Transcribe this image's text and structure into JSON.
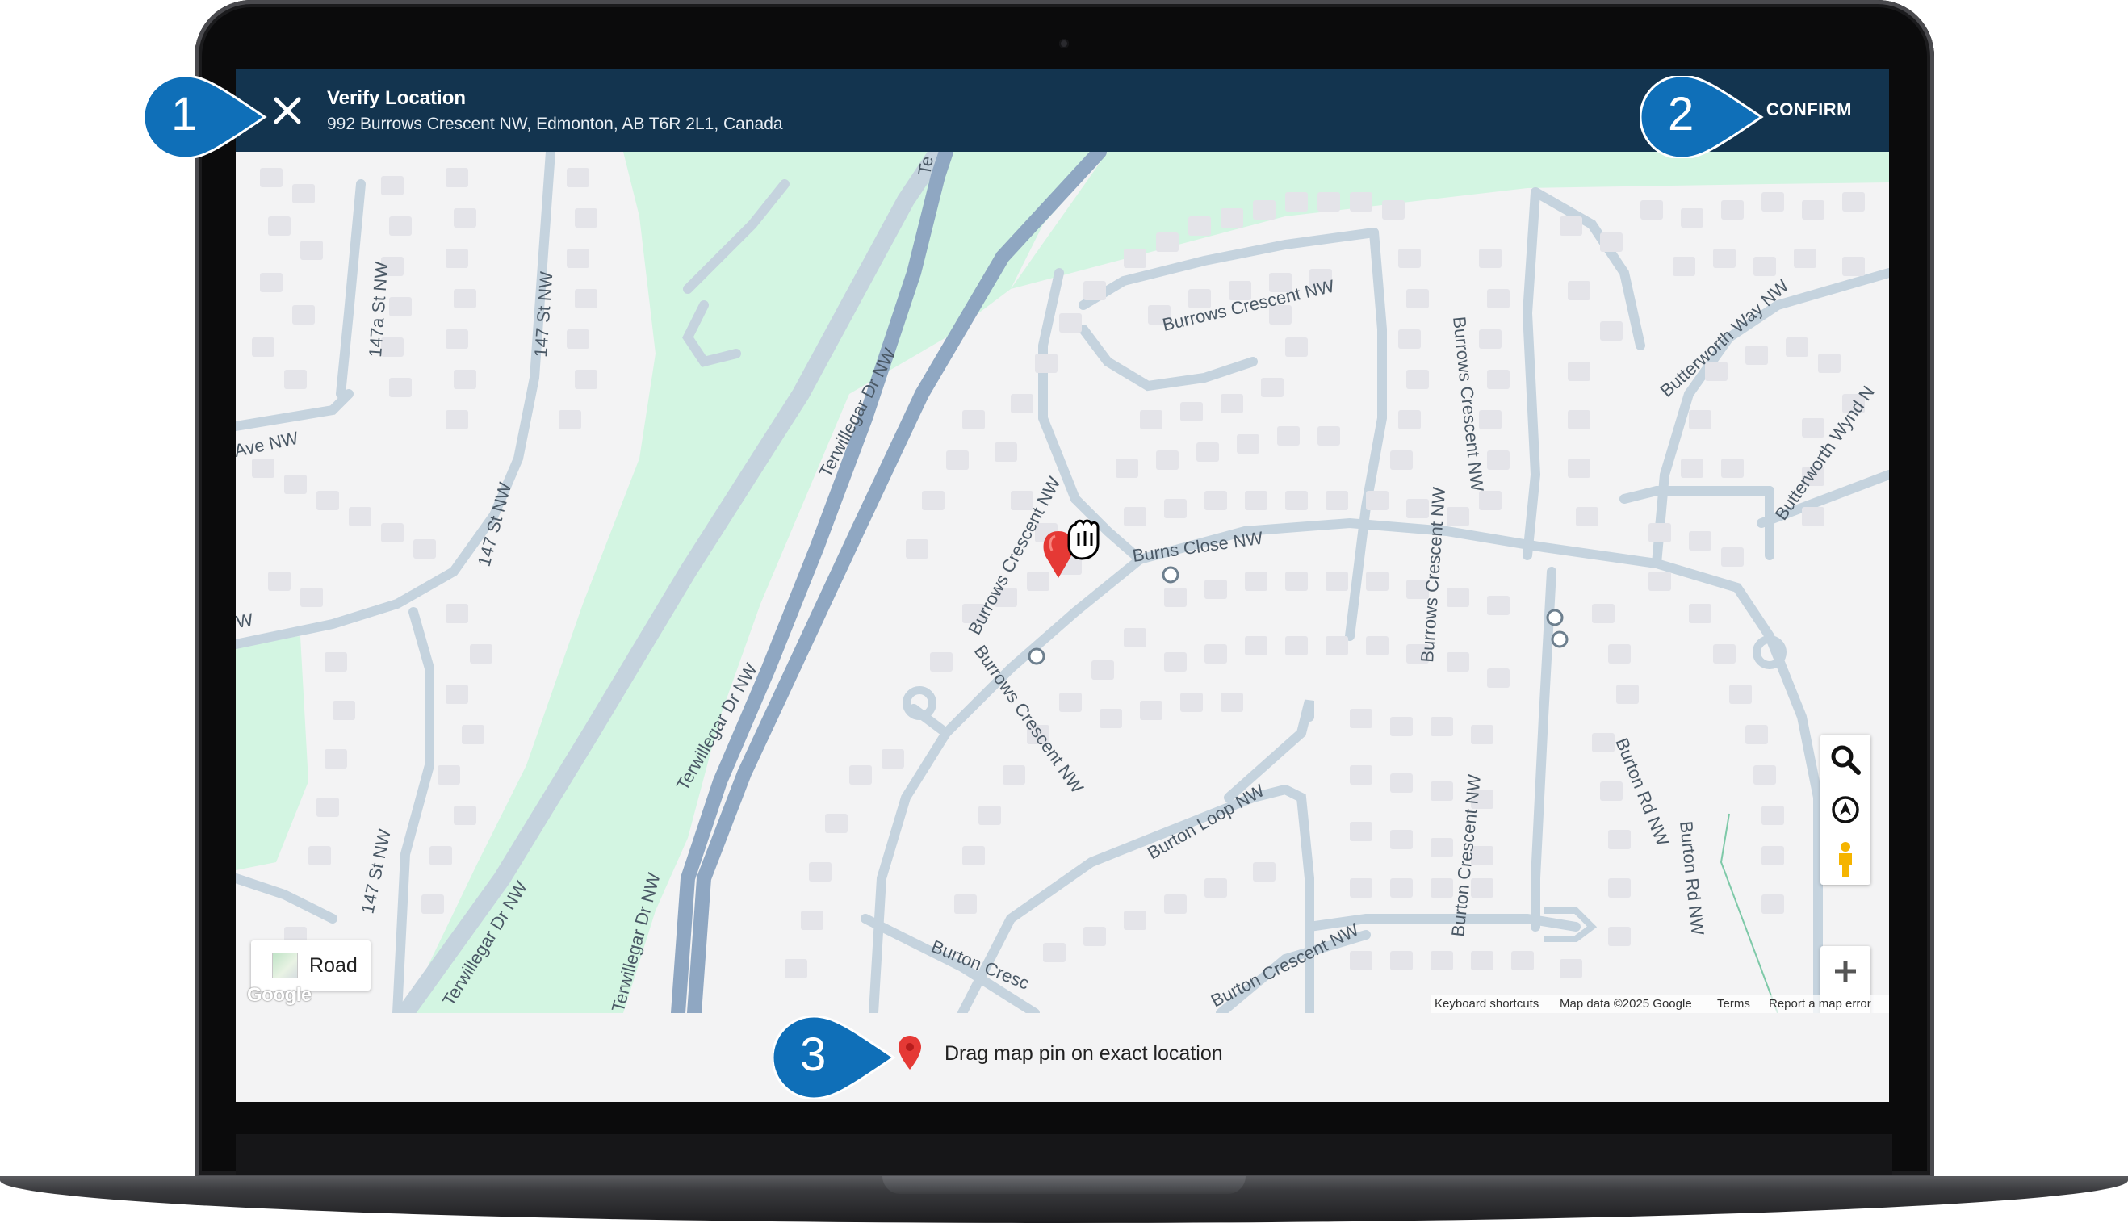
{
  "header": {
    "title": "Verify Location",
    "address": "992 Burrows Crescent NW, Edmonton, AB T6R 2L1, Canada",
    "confirm_label": "CONFIRM"
  },
  "map": {
    "map_type_label": "Road",
    "logo_text": "Google",
    "attribution": {
      "shortcuts": "Keyboard shortcuts",
      "map_data": "Map data ©2025 Google",
      "terms": "Terms",
      "report": "Report a map error"
    },
    "street_labels": {
      "s147a": "147a St NW",
      "s147_top": "147 St NW",
      "ave": "Ave NW",
      "s147_mid": "147 St NW",
      "w": "W",
      "s147_low": "147 St NW",
      "terw_top": "Terwillegar Dr NW",
      "te": "Te",
      "terw_mid": "Terwillegar Dr NW",
      "terw_bl": "Terwillegar Dr NW",
      "terw_b": "Terwillegar Dr NW",
      "burrows_top": "Burrows Crescent NW",
      "burrows_v1": "Burrows Crescent NW",
      "burrows_v2": "Burrows Crescent NW",
      "burrows_diag1": "Burrows Crescent NW",
      "burrows_diag2": "Burrows Crescent NW",
      "burns_close": "Burns Close NW",
      "butterworth_way": "Butterworth Way NW",
      "butterworth_wynd": "Butterworth Wynd N",
      "burton_loop": "Burton Loop NW",
      "burton_cres_v": "Burton Crescent NW",
      "burton_cres_b": "Burton Crescent NW",
      "burton_cresc": "Burton Cresc",
      "burton_rd1": "Burton Rd NW",
      "burton_rd2": "Burton Rd NW"
    },
    "pin_color": "#e53935",
    "water_green": "#d3f5e2",
    "road_color": "#c5d3de",
    "highway_color": "#8fa7c2"
  },
  "footer": {
    "hint": "Drag map pin on exact location"
  },
  "callouts": {
    "c1": "1",
    "c2": "2",
    "c3": "3",
    "color": "#0f6fb8"
  },
  "colors": {
    "header_bg": "#13344f",
    "accent": "#0f6fb8"
  }
}
